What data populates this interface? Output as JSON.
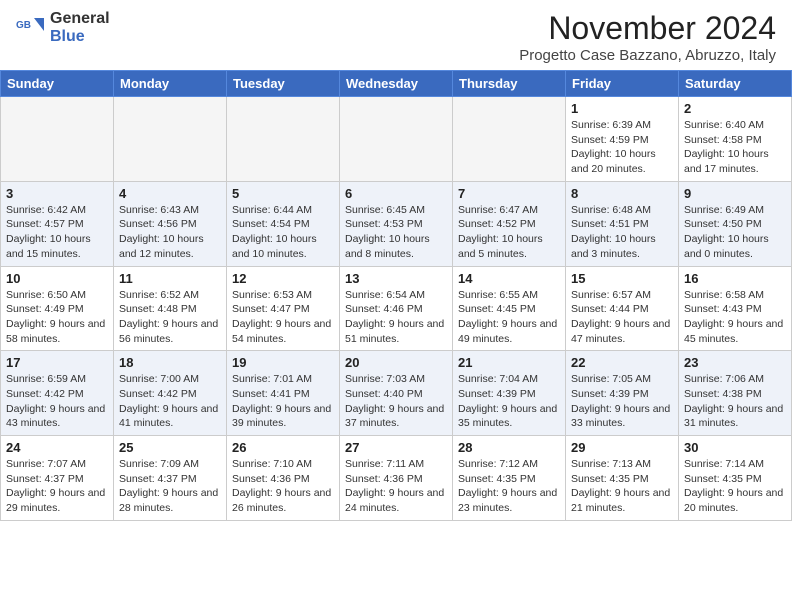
{
  "header": {
    "logo_general": "General",
    "logo_blue": "Blue",
    "month_title": "November 2024",
    "location": "Progetto Case Bazzano, Abruzzo, Italy"
  },
  "days_of_week": [
    "Sunday",
    "Monday",
    "Tuesday",
    "Wednesday",
    "Thursday",
    "Friday",
    "Saturday"
  ],
  "weeks": [
    [
      {
        "day": "",
        "info": ""
      },
      {
        "day": "",
        "info": ""
      },
      {
        "day": "",
        "info": ""
      },
      {
        "day": "",
        "info": ""
      },
      {
        "day": "",
        "info": ""
      },
      {
        "day": "1",
        "info": "Sunrise: 6:39 AM\nSunset: 4:59 PM\nDaylight: 10 hours and 20 minutes."
      },
      {
        "day": "2",
        "info": "Sunrise: 6:40 AM\nSunset: 4:58 PM\nDaylight: 10 hours and 17 minutes."
      }
    ],
    [
      {
        "day": "3",
        "info": "Sunrise: 6:42 AM\nSunset: 4:57 PM\nDaylight: 10 hours and 15 minutes."
      },
      {
        "day": "4",
        "info": "Sunrise: 6:43 AM\nSunset: 4:56 PM\nDaylight: 10 hours and 12 minutes."
      },
      {
        "day": "5",
        "info": "Sunrise: 6:44 AM\nSunset: 4:54 PM\nDaylight: 10 hours and 10 minutes."
      },
      {
        "day": "6",
        "info": "Sunrise: 6:45 AM\nSunset: 4:53 PM\nDaylight: 10 hours and 8 minutes."
      },
      {
        "day": "7",
        "info": "Sunrise: 6:47 AM\nSunset: 4:52 PM\nDaylight: 10 hours and 5 minutes."
      },
      {
        "day": "8",
        "info": "Sunrise: 6:48 AM\nSunset: 4:51 PM\nDaylight: 10 hours and 3 minutes."
      },
      {
        "day": "9",
        "info": "Sunrise: 6:49 AM\nSunset: 4:50 PM\nDaylight: 10 hours and 0 minutes."
      }
    ],
    [
      {
        "day": "10",
        "info": "Sunrise: 6:50 AM\nSunset: 4:49 PM\nDaylight: 9 hours and 58 minutes."
      },
      {
        "day": "11",
        "info": "Sunrise: 6:52 AM\nSunset: 4:48 PM\nDaylight: 9 hours and 56 minutes."
      },
      {
        "day": "12",
        "info": "Sunrise: 6:53 AM\nSunset: 4:47 PM\nDaylight: 9 hours and 54 minutes."
      },
      {
        "day": "13",
        "info": "Sunrise: 6:54 AM\nSunset: 4:46 PM\nDaylight: 9 hours and 51 minutes."
      },
      {
        "day": "14",
        "info": "Sunrise: 6:55 AM\nSunset: 4:45 PM\nDaylight: 9 hours and 49 minutes."
      },
      {
        "day": "15",
        "info": "Sunrise: 6:57 AM\nSunset: 4:44 PM\nDaylight: 9 hours and 47 minutes."
      },
      {
        "day": "16",
        "info": "Sunrise: 6:58 AM\nSunset: 4:43 PM\nDaylight: 9 hours and 45 minutes."
      }
    ],
    [
      {
        "day": "17",
        "info": "Sunrise: 6:59 AM\nSunset: 4:42 PM\nDaylight: 9 hours and 43 minutes."
      },
      {
        "day": "18",
        "info": "Sunrise: 7:00 AM\nSunset: 4:42 PM\nDaylight: 9 hours and 41 minutes."
      },
      {
        "day": "19",
        "info": "Sunrise: 7:01 AM\nSunset: 4:41 PM\nDaylight: 9 hours and 39 minutes."
      },
      {
        "day": "20",
        "info": "Sunrise: 7:03 AM\nSunset: 4:40 PM\nDaylight: 9 hours and 37 minutes."
      },
      {
        "day": "21",
        "info": "Sunrise: 7:04 AM\nSunset: 4:39 PM\nDaylight: 9 hours and 35 minutes."
      },
      {
        "day": "22",
        "info": "Sunrise: 7:05 AM\nSunset: 4:39 PM\nDaylight: 9 hours and 33 minutes."
      },
      {
        "day": "23",
        "info": "Sunrise: 7:06 AM\nSunset: 4:38 PM\nDaylight: 9 hours and 31 minutes."
      }
    ],
    [
      {
        "day": "24",
        "info": "Sunrise: 7:07 AM\nSunset: 4:37 PM\nDaylight: 9 hours and 29 minutes."
      },
      {
        "day": "25",
        "info": "Sunrise: 7:09 AM\nSunset: 4:37 PM\nDaylight: 9 hours and 28 minutes."
      },
      {
        "day": "26",
        "info": "Sunrise: 7:10 AM\nSunset: 4:36 PM\nDaylight: 9 hours and 26 minutes."
      },
      {
        "day": "27",
        "info": "Sunrise: 7:11 AM\nSunset: 4:36 PM\nDaylight: 9 hours and 24 minutes."
      },
      {
        "day": "28",
        "info": "Sunrise: 7:12 AM\nSunset: 4:35 PM\nDaylight: 9 hours and 23 minutes."
      },
      {
        "day": "29",
        "info": "Sunrise: 7:13 AM\nSunset: 4:35 PM\nDaylight: 9 hours and 21 minutes."
      },
      {
        "day": "30",
        "info": "Sunrise: 7:14 AM\nSunset: 4:35 PM\nDaylight: 9 hours and 20 minutes."
      }
    ]
  ]
}
